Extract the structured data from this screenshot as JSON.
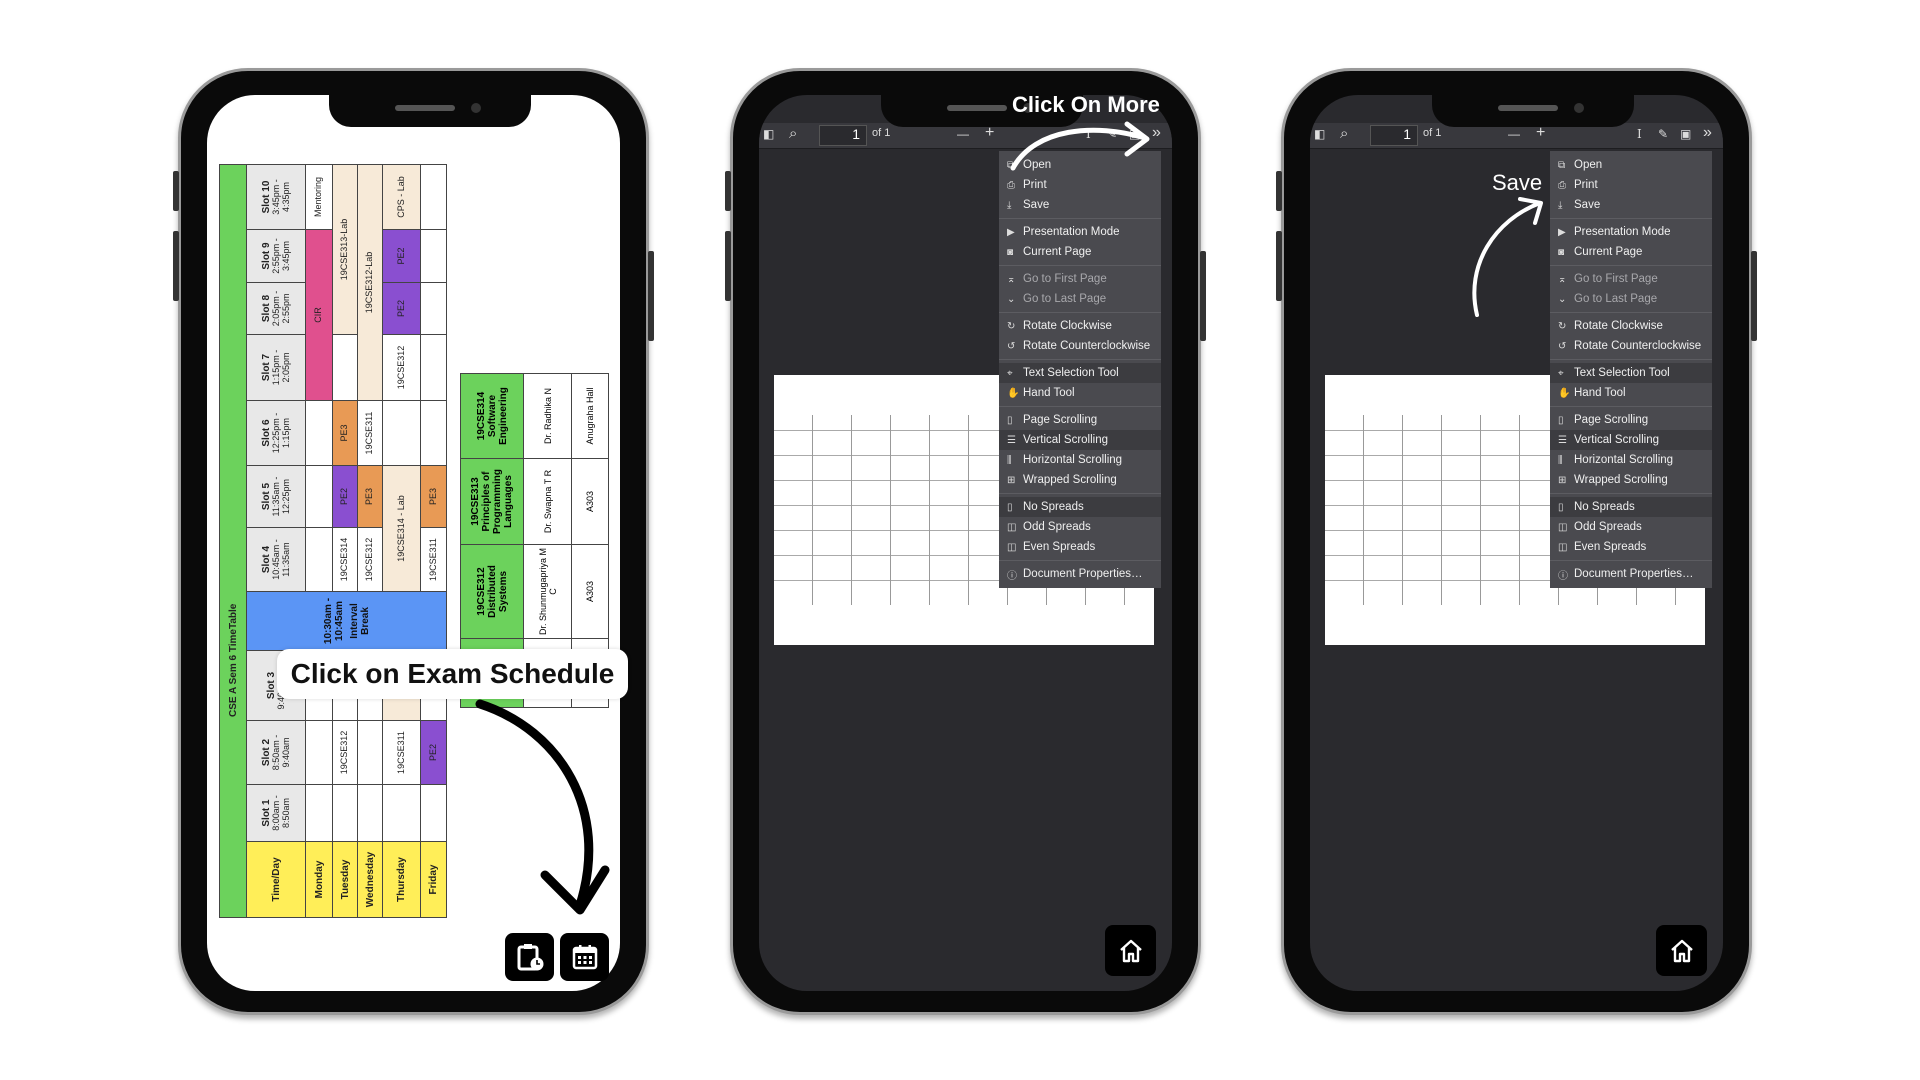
{
  "colors": {
    "green": "#6cd25c",
    "yellow": "#ffee58",
    "blue": "#5b95f5",
    "pink": "#e0508e",
    "purple": "#8a4fd0",
    "orange": "#e89a55",
    "beige": "#f7ead8",
    "gray": "#e8e8e8",
    "white": "#ffffff"
  },
  "timetable": {
    "title": "CSE A Sem 6 TimeTable",
    "time_day": "Time/Day",
    "slots": [
      {
        "name": "Slot 1",
        "time": "8:00am - 8:50am"
      },
      {
        "name": "Slot 2",
        "time": "8:50am - 9:40am"
      },
      {
        "name": "Slot 3",
        "time": "9:40am - 10"
      },
      {
        "name": "Slot 4",
        "time": "10:45am - 11:35am"
      },
      {
        "name": "Slot 5",
        "time": "11:35am - 12:25pm"
      },
      {
        "name": "Slot 6",
        "time": "12:25pm - 1:15pm"
      },
      {
        "name": "Slot 7",
        "time": "1:15pm - 2:05pm"
      },
      {
        "name": "Slot 8",
        "time": "2:05pm - 2:55pm"
      },
      {
        "name": "Slot 9",
        "time": "2:55pm - 3:45pm"
      },
      {
        "name": "Slot 10",
        "time": "3:45pm - 4:35pm"
      }
    ],
    "break": {
      "time": "10:30am - 10:45am",
      "label": "Interval Break"
    },
    "rows": [
      {
        "day": "Monday",
        "cells": [
          {
            "t": ""
          },
          {
            "t": ""
          },
          {
            "t": "19"
          },
          {
            "t": ""
          },
          {
            "t": ""
          },
          {
            "t": ""
          },
          {
            "t": "CIR",
            "c": "pink",
            "span": 3
          },
          {
            "t": "Mentoring"
          }
        ]
      },
      {
        "day": "Tuesday",
        "cells": [
          {
            "t": ""
          },
          {
            "t": "19CSE312"
          },
          {
            "t": "19"
          },
          {
            "t": "19CSE314"
          },
          {
            "t": "PE2",
            "c": "purple"
          },
          {
            "t": "PE3",
            "c": "orange"
          },
          {
            "t": ""
          },
          {
            "t": "19CSE313-Lab",
            "c": "beige",
            "span": 3
          }
        ]
      },
      {
        "day": "Wednesday",
        "cells": [
          {
            "t": ""
          },
          {
            "t": ""
          },
          {
            "t": "19"
          },
          {
            "t": "19CSE312"
          },
          {
            "t": "PE3",
            "c": "orange"
          },
          {
            "t": "19CSE311"
          },
          {
            "t": "19CSE312-Lab",
            "c": "beige",
            "span": 4
          }
        ]
      },
      {
        "day": "Thursday",
        "cells": [
          {
            "t": ""
          },
          {
            "t": "19CSE311"
          },
          {
            "t": "19",
            "c": "beige"
          },
          {
            "t": "19CSE314 - Lab",
            "c": "beige",
            "span": 2
          },
          {
            "t": ""
          },
          {
            "t": "19CSE312"
          },
          {
            "t": "PE2",
            "c": "purple"
          },
          {
            "t": "PE2",
            "c": "purple"
          },
          {
            "t": "CPS - Lab",
            "c": "beige"
          }
        ]
      },
      {
        "day": "Friday",
        "cells": [
          {
            "t": ""
          },
          {
            "t": "PE2",
            "c": "purple"
          },
          {
            "t": ""
          },
          {
            "t": "19CSE311"
          },
          {
            "t": "PE3",
            "c": "orange"
          },
          {
            "t": ""
          },
          {
            "t": ""
          },
          {
            "t": ""
          },
          {
            "t": ""
          },
          {
            "t": ""
          }
        ]
      }
    ]
  },
  "subjects": [
    {
      "code": "19CSE312",
      "name": "Distributed Systems",
      "teacher": "Dr. Shunmugapriya M C",
      "room": "A303"
    },
    {
      "code": "19CSE313",
      "name": "Principles of Programming Languages",
      "teacher": "Dr. Swapna T R",
      "room": "A303"
    },
    {
      "code": "19CSE314",
      "name": "Software Engineering",
      "teacher": "Dr. Radhika N",
      "room": "Anugraha Hall"
    }
  ],
  "phone1": {
    "callout": "Click on Exam Schedule",
    "buttons": [
      {
        "icon": "clipboard-clock-icon"
      },
      {
        "icon": "calendar-icon"
      }
    ]
  },
  "phone2": {
    "annotation": "Click On More"
  },
  "phone3": {
    "annotation": "Save"
  },
  "viewer": {
    "page": "1",
    "page_count": "of 1",
    "menu": [
      [
        {
          "label": "Open",
          "icon": "open-icon",
          "g": "⧉"
        },
        {
          "label": "Print",
          "icon": "print-icon",
          "g": "⎙"
        },
        {
          "label": "Save",
          "icon": "save-icon",
          "g": "⤓"
        }
      ],
      [
        {
          "label": "Presentation Mode",
          "icon": "presentation-icon",
          "g": "▶"
        },
        {
          "label": "Current Page",
          "icon": "current-page-icon",
          "g": "◙"
        }
      ],
      [
        {
          "label": "Go to First Page",
          "icon": "first-page-icon",
          "g": "⌅",
          "disabled": true
        },
        {
          "label": "Go to Last Page",
          "icon": "last-page-icon",
          "g": "⌄",
          "disabled": true
        }
      ],
      [
        {
          "label": "Rotate Clockwise",
          "icon": "rotate-cw-icon",
          "g": "↻"
        },
        {
          "label": "Rotate Counterclockwise",
          "icon": "rotate-ccw-icon",
          "g": "↺"
        }
      ],
      [
        {
          "label": "Text Selection Tool",
          "icon": "text-select-icon",
          "g": "⌖",
          "selected": true
        },
        {
          "label": "Hand Tool",
          "icon": "hand-icon",
          "g": "✋"
        }
      ],
      [
        {
          "label": "Page Scrolling",
          "icon": "page-scroll-icon",
          "g": "▯"
        },
        {
          "label": "Vertical Scrolling",
          "icon": "vertical-scroll-icon",
          "g": "☰",
          "selected": true
        },
        {
          "label": "Horizontal Scrolling",
          "icon": "horizontal-scroll-icon",
          "g": "⫼"
        },
        {
          "label": "Wrapped Scrolling",
          "icon": "wrapped-scroll-icon",
          "g": "⊞"
        }
      ],
      [
        {
          "label": "No Spreads",
          "icon": "no-spreads-icon",
          "g": "▯",
          "selected": true
        },
        {
          "label": "Odd Spreads",
          "icon": "odd-spreads-icon",
          "g": "◫"
        },
        {
          "label": "Even Spreads",
          "icon": "even-spreads-icon",
          "g": "◫"
        }
      ],
      [
        {
          "label": "Document Properties…",
          "icon": "info-icon",
          "g": "ⓘ"
        }
      ]
    ]
  }
}
